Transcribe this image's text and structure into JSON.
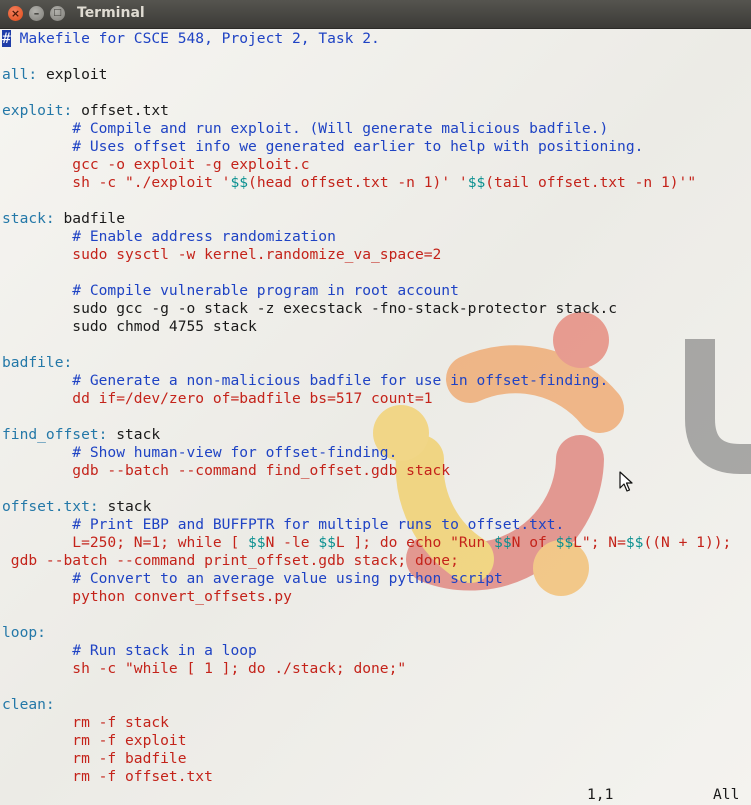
{
  "window": {
    "title": "Terminal"
  },
  "buttons": {
    "close": "×",
    "minimize": "–",
    "maximize": "□"
  },
  "lines": [
    [
      [
        "cursor",
        "#"
      ],
      [
        "c",
        " Makefile for CSCE 548, Project 2, Task 2."
      ]
    ],
    [],
    [
      [
        "k",
        "all:"
      ],
      [
        "t",
        " exploit"
      ]
    ],
    [],
    [
      [
        "k",
        "exploit:"
      ],
      [
        "t",
        " offset.txt"
      ]
    ],
    [
      [
        "c",
        "        # Compile and run exploit. (Will generate malicious badfile.)"
      ]
    ],
    [
      [
        "c",
        "        # Uses offset info we generated earlier to help with positioning."
      ]
    ],
    [
      [
        "r",
        "        gcc -o exploit -g exploit.c"
      ]
    ],
    [
      [
        "r",
        "        sh -c \"./exploit '"
      ],
      [
        "p",
        "$$"
      ],
      [
        "r",
        "(head offset.txt -n 1)' '"
      ],
      [
        "p",
        "$$"
      ],
      [
        "r",
        "(tail offset.txt -n 1)'\""
      ]
    ],
    [],
    [
      [
        "k",
        "stack:"
      ],
      [
        "t",
        " badfile"
      ]
    ],
    [
      [
        "c",
        "        # Enable address randomization"
      ]
    ],
    [
      [
        "r",
        "        sudo sysctl -w kernel.randomize_va_space=2"
      ]
    ],
    [],
    [
      [
        "c",
        "        # Compile vulnerable program in root account"
      ]
    ],
    [
      [
        "t",
        "        sudo gcc -g -o stack -z execstack -fno-stack-protector stack.c"
      ]
    ],
    [
      [
        "t",
        "        sudo chmod 4755 stack"
      ]
    ],
    [],
    [
      [
        "k",
        "badfile:"
      ]
    ],
    [
      [
        "c",
        "        # Generate a non-malicious badfile for use in offset-finding."
      ]
    ],
    [
      [
        "r",
        "        dd if=/dev/zero of=badfile bs=517 count=1"
      ]
    ],
    [],
    [
      [
        "k",
        "find_offset:"
      ],
      [
        "t",
        " stack"
      ]
    ],
    [
      [
        "c",
        "        # Show human-view for offset-finding."
      ]
    ],
    [
      [
        "r",
        "        gdb --batch --command find_offset.gdb stack"
      ]
    ],
    [],
    [
      [
        "k",
        "offset.txt:"
      ],
      [
        "t",
        " stack"
      ]
    ],
    [
      [
        "c",
        "        # Print EBP and BUFFPTR for multiple runs to offset.txt."
      ]
    ],
    [
      [
        "r",
        "        L=250; N=1; while [ "
      ],
      [
        "p",
        "$$"
      ],
      [
        "r",
        "N -le "
      ],
      [
        "p",
        "$$"
      ],
      [
        "r",
        "L ]; do echo \"Run "
      ],
      [
        "p",
        "$$"
      ],
      [
        "r",
        "N of "
      ],
      [
        "p",
        "$$"
      ],
      [
        "r",
        "L\"; N="
      ],
      [
        "p",
        "$$"
      ],
      [
        "r",
        "((N + 1));"
      ]
    ],
    [
      [
        "r",
        " gdb --batch --command print_offset.gdb stack; done;"
      ]
    ],
    [
      [
        "c",
        "        # Convert to an average value using python script"
      ]
    ],
    [
      [
        "r",
        "        python convert_offsets.py"
      ]
    ],
    [],
    [
      [
        "k",
        "loop:"
      ]
    ],
    [
      [
        "c",
        "        # Run stack in a loop"
      ]
    ],
    [
      [
        "r",
        "        sh -c \"while [ 1 ]; do ./stack; done;\""
      ]
    ],
    [],
    [
      [
        "k",
        "clean:"
      ]
    ],
    [
      [
        "r",
        "        rm -f stack"
      ]
    ],
    [
      [
        "r",
        "        rm -f exploit"
      ]
    ],
    [
      [
        "r",
        "        rm -f badfile"
      ]
    ],
    [
      [
        "r",
        "        rm -f offset.txt"
      ]
    ]
  ],
  "status": {
    "position": "1,1",
    "scroll": "All"
  },
  "colors": {
    "comment": "#1f43c4",
    "target": "#2478a8",
    "command": "#c4231a",
    "variable": "#0a9090",
    "text": "#1a1a1a",
    "cursor_bg": "#1f3da8"
  }
}
